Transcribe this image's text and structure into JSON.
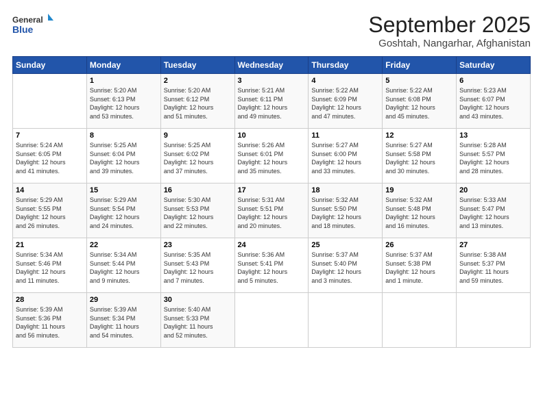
{
  "logo": {
    "general": "General",
    "blue": "Blue"
  },
  "title": "September 2025",
  "subtitle": "Goshtah, Nangarhar, Afghanistan",
  "headers": [
    "Sunday",
    "Monday",
    "Tuesday",
    "Wednesday",
    "Thursday",
    "Friday",
    "Saturday"
  ],
  "weeks": [
    [
      {
        "num": "",
        "detail": ""
      },
      {
        "num": "1",
        "detail": "Sunrise: 5:20 AM\nSunset: 6:13 PM\nDaylight: 12 hours\nand 53 minutes."
      },
      {
        "num": "2",
        "detail": "Sunrise: 5:20 AM\nSunset: 6:12 PM\nDaylight: 12 hours\nand 51 minutes."
      },
      {
        "num": "3",
        "detail": "Sunrise: 5:21 AM\nSunset: 6:11 PM\nDaylight: 12 hours\nand 49 minutes."
      },
      {
        "num": "4",
        "detail": "Sunrise: 5:22 AM\nSunset: 6:09 PM\nDaylight: 12 hours\nand 47 minutes."
      },
      {
        "num": "5",
        "detail": "Sunrise: 5:22 AM\nSunset: 6:08 PM\nDaylight: 12 hours\nand 45 minutes."
      },
      {
        "num": "6",
        "detail": "Sunrise: 5:23 AM\nSunset: 6:07 PM\nDaylight: 12 hours\nand 43 minutes."
      }
    ],
    [
      {
        "num": "7",
        "detail": "Sunrise: 5:24 AM\nSunset: 6:05 PM\nDaylight: 12 hours\nand 41 minutes."
      },
      {
        "num": "8",
        "detail": "Sunrise: 5:25 AM\nSunset: 6:04 PM\nDaylight: 12 hours\nand 39 minutes."
      },
      {
        "num": "9",
        "detail": "Sunrise: 5:25 AM\nSunset: 6:02 PM\nDaylight: 12 hours\nand 37 minutes."
      },
      {
        "num": "10",
        "detail": "Sunrise: 5:26 AM\nSunset: 6:01 PM\nDaylight: 12 hours\nand 35 minutes."
      },
      {
        "num": "11",
        "detail": "Sunrise: 5:27 AM\nSunset: 6:00 PM\nDaylight: 12 hours\nand 33 minutes."
      },
      {
        "num": "12",
        "detail": "Sunrise: 5:27 AM\nSunset: 5:58 PM\nDaylight: 12 hours\nand 30 minutes."
      },
      {
        "num": "13",
        "detail": "Sunrise: 5:28 AM\nSunset: 5:57 PM\nDaylight: 12 hours\nand 28 minutes."
      }
    ],
    [
      {
        "num": "14",
        "detail": "Sunrise: 5:29 AM\nSunset: 5:55 PM\nDaylight: 12 hours\nand 26 minutes."
      },
      {
        "num": "15",
        "detail": "Sunrise: 5:29 AM\nSunset: 5:54 PM\nDaylight: 12 hours\nand 24 minutes."
      },
      {
        "num": "16",
        "detail": "Sunrise: 5:30 AM\nSunset: 5:53 PM\nDaylight: 12 hours\nand 22 minutes."
      },
      {
        "num": "17",
        "detail": "Sunrise: 5:31 AM\nSunset: 5:51 PM\nDaylight: 12 hours\nand 20 minutes."
      },
      {
        "num": "18",
        "detail": "Sunrise: 5:32 AM\nSunset: 5:50 PM\nDaylight: 12 hours\nand 18 minutes."
      },
      {
        "num": "19",
        "detail": "Sunrise: 5:32 AM\nSunset: 5:48 PM\nDaylight: 12 hours\nand 16 minutes."
      },
      {
        "num": "20",
        "detail": "Sunrise: 5:33 AM\nSunset: 5:47 PM\nDaylight: 12 hours\nand 13 minutes."
      }
    ],
    [
      {
        "num": "21",
        "detail": "Sunrise: 5:34 AM\nSunset: 5:46 PM\nDaylight: 12 hours\nand 11 minutes."
      },
      {
        "num": "22",
        "detail": "Sunrise: 5:34 AM\nSunset: 5:44 PM\nDaylight: 12 hours\nand 9 minutes."
      },
      {
        "num": "23",
        "detail": "Sunrise: 5:35 AM\nSunset: 5:43 PM\nDaylight: 12 hours\nand 7 minutes."
      },
      {
        "num": "24",
        "detail": "Sunrise: 5:36 AM\nSunset: 5:41 PM\nDaylight: 12 hours\nand 5 minutes."
      },
      {
        "num": "25",
        "detail": "Sunrise: 5:37 AM\nSunset: 5:40 PM\nDaylight: 12 hours\nand 3 minutes."
      },
      {
        "num": "26",
        "detail": "Sunrise: 5:37 AM\nSunset: 5:38 PM\nDaylight: 12 hours\nand 1 minute."
      },
      {
        "num": "27",
        "detail": "Sunrise: 5:38 AM\nSunset: 5:37 PM\nDaylight: 11 hours\nand 59 minutes."
      }
    ],
    [
      {
        "num": "28",
        "detail": "Sunrise: 5:39 AM\nSunset: 5:36 PM\nDaylight: 11 hours\nand 56 minutes."
      },
      {
        "num": "29",
        "detail": "Sunrise: 5:39 AM\nSunset: 5:34 PM\nDaylight: 11 hours\nand 54 minutes."
      },
      {
        "num": "30",
        "detail": "Sunrise: 5:40 AM\nSunset: 5:33 PM\nDaylight: 11 hours\nand 52 minutes."
      },
      {
        "num": "",
        "detail": ""
      },
      {
        "num": "",
        "detail": ""
      },
      {
        "num": "",
        "detail": ""
      },
      {
        "num": "",
        "detail": ""
      }
    ]
  ]
}
